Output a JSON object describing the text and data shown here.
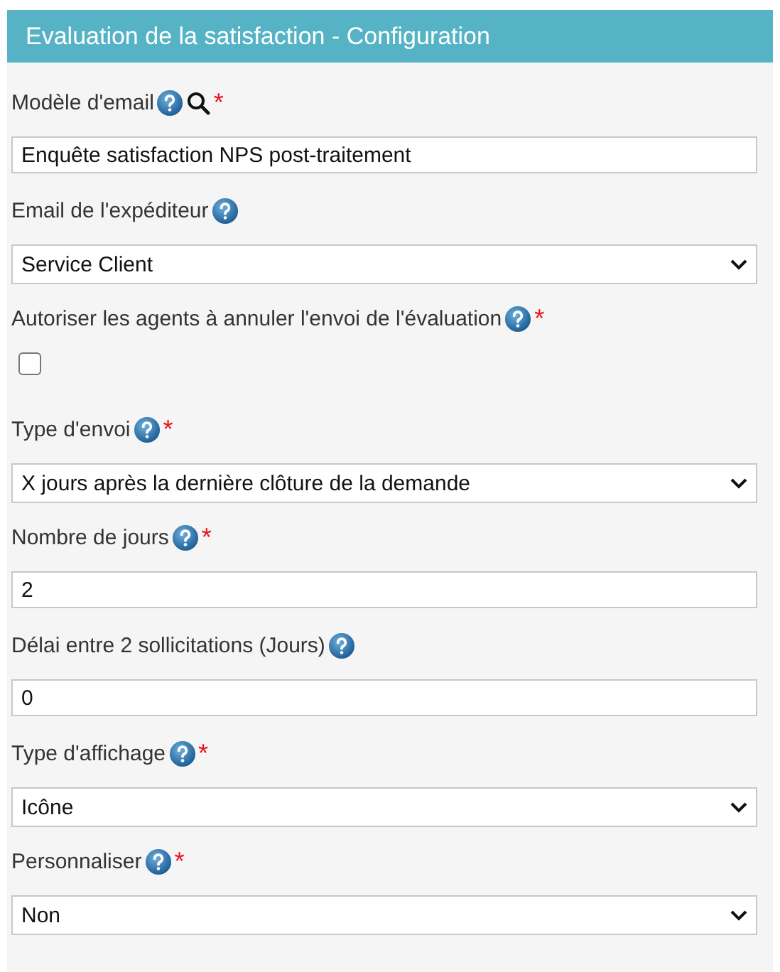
{
  "panel": {
    "title": "Evaluation de la satisfaction - Configuration"
  },
  "fields": [
    {
      "label": "Modèle d'email",
      "search": true,
      "required_mark": "*",
      "kind": "text",
      "value": "Enquête satisfaction NPS post-traitement"
    },
    {
      "label": "Email de l'expéditeur",
      "search": false,
      "kind": "select",
      "value": "Service Client"
    },
    {
      "label": "Autoriser les agents à annuler l'envoi de l'évaluation",
      "search": false,
      "required_mark": "*",
      "kind": "checkbox",
      "checked": false
    },
    {
      "label": "Type d'envoi",
      "search": false,
      "required_mark": "*",
      "kind": "select",
      "value": "X jours après la dernière clôture de la demande"
    },
    {
      "label": "Nombre de jours",
      "search": false,
      "required_mark": "*",
      "kind": "text",
      "value": "2"
    },
    {
      "label": "Délai entre 2 sollicitations (Jours)",
      "search": false,
      "kind": "text",
      "value": "0"
    },
    {
      "label": "Type d'affichage",
      "search": false,
      "required_mark": "*",
      "kind": "select",
      "value": "Icône"
    },
    {
      "label": "Personnaliser",
      "search": false,
      "required_mark": "*",
      "kind": "select",
      "value": "Non"
    }
  ]
}
